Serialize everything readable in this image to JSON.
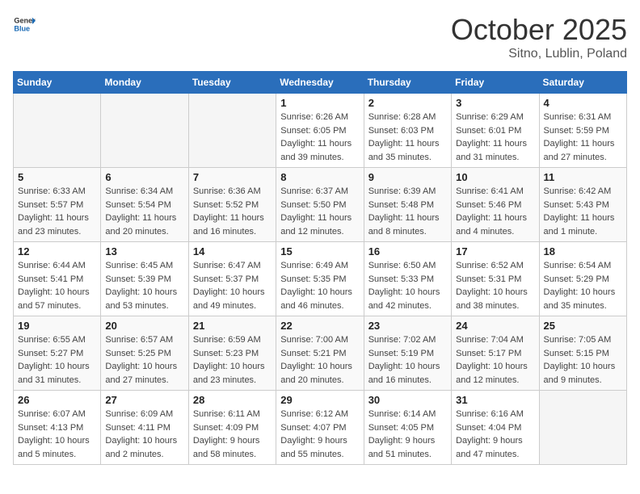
{
  "header": {
    "logo_line1": "General",
    "logo_line2": "Blue",
    "month": "October 2025",
    "location": "Sitno, Lublin, Poland"
  },
  "weekdays": [
    "Sunday",
    "Monday",
    "Tuesday",
    "Wednesday",
    "Thursday",
    "Friday",
    "Saturday"
  ],
  "weeks": [
    [
      {
        "day": "",
        "info": ""
      },
      {
        "day": "",
        "info": ""
      },
      {
        "day": "",
        "info": ""
      },
      {
        "day": "1",
        "info": "Sunrise: 6:26 AM\nSunset: 6:05 PM\nDaylight: 11 hours\nand 39 minutes."
      },
      {
        "day": "2",
        "info": "Sunrise: 6:28 AM\nSunset: 6:03 PM\nDaylight: 11 hours\nand 35 minutes."
      },
      {
        "day": "3",
        "info": "Sunrise: 6:29 AM\nSunset: 6:01 PM\nDaylight: 11 hours\nand 31 minutes."
      },
      {
        "day": "4",
        "info": "Sunrise: 6:31 AM\nSunset: 5:59 PM\nDaylight: 11 hours\nand 27 minutes."
      }
    ],
    [
      {
        "day": "5",
        "info": "Sunrise: 6:33 AM\nSunset: 5:57 PM\nDaylight: 11 hours\nand 23 minutes."
      },
      {
        "day": "6",
        "info": "Sunrise: 6:34 AM\nSunset: 5:54 PM\nDaylight: 11 hours\nand 20 minutes."
      },
      {
        "day": "7",
        "info": "Sunrise: 6:36 AM\nSunset: 5:52 PM\nDaylight: 11 hours\nand 16 minutes."
      },
      {
        "day": "8",
        "info": "Sunrise: 6:37 AM\nSunset: 5:50 PM\nDaylight: 11 hours\nand 12 minutes."
      },
      {
        "day": "9",
        "info": "Sunrise: 6:39 AM\nSunset: 5:48 PM\nDaylight: 11 hours\nand 8 minutes."
      },
      {
        "day": "10",
        "info": "Sunrise: 6:41 AM\nSunset: 5:46 PM\nDaylight: 11 hours\nand 4 minutes."
      },
      {
        "day": "11",
        "info": "Sunrise: 6:42 AM\nSunset: 5:43 PM\nDaylight: 11 hours\nand 1 minute."
      }
    ],
    [
      {
        "day": "12",
        "info": "Sunrise: 6:44 AM\nSunset: 5:41 PM\nDaylight: 10 hours\nand 57 minutes."
      },
      {
        "day": "13",
        "info": "Sunrise: 6:45 AM\nSunset: 5:39 PM\nDaylight: 10 hours\nand 53 minutes."
      },
      {
        "day": "14",
        "info": "Sunrise: 6:47 AM\nSunset: 5:37 PM\nDaylight: 10 hours\nand 49 minutes."
      },
      {
        "day": "15",
        "info": "Sunrise: 6:49 AM\nSunset: 5:35 PM\nDaylight: 10 hours\nand 46 minutes."
      },
      {
        "day": "16",
        "info": "Sunrise: 6:50 AM\nSunset: 5:33 PM\nDaylight: 10 hours\nand 42 minutes."
      },
      {
        "day": "17",
        "info": "Sunrise: 6:52 AM\nSunset: 5:31 PM\nDaylight: 10 hours\nand 38 minutes."
      },
      {
        "day": "18",
        "info": "Sunrise: 6:54 AM\nSunset: 5:29 PM\nDaylight: 10 hours\nand 35 minutes."
      }
    ],
    [
      {
        "day": "19",
        "info": "Sunrise: 6:55 AM\nSunset: 5:27 PM\nDaylight: 10 hours\nand 31 minutes."
      },
      {
        "day": "20",
        "info": "Sunrise: 6:57 AM\nSunset: 5:25 PM\nDaylight: 10 hours\nand 27 minutes."
      },
      {
        "day": "21",
        "info": "Sunrise: 6:59 AM\nSunset: 5:23 PM\nDaylight: 10 hours\nand 23 minutes."
      },
      {
        "day": "22",
        "info": "Sunrise: 7:00 AM\nSunset: 5:21 PM\nDaylight: 10 hours\nand 20 minutes."
      },
      {
        "day": "23",
        "info": "Sunrise: 7:02 AM\nSunset: 5:19 PM\nDaylight: 10 hours\nand 16 minutes."
      },
      {
        "day": "24",
        "info": "Sunrise: 7:04 AM\nSunset: 5:17 PM\nDaylight: 10 hours\nand 12 minutes."
      },
      {
        "day": "25",
        "info": "Sunrise: 7:05 AM\nSunset: 5:15 PM\nDaylight: 10 hours\nand 9 minutes."
      }
    ],
    [
      {
        "day": "26",
        "info": "Sunrise: 6:07 AM\nSunset: 4:13 PM\nDaylight: 10 hours\nand 5 minutes."
      },
      {
        "day": "27",
        "info": "Sunrise: 6:09 AM\nSunset: 4:11 PM\nDaylight: 10 hours\nand 2 minutes."
      },
      {
        "day": "28",
        "info": "Sunrise: 6:11 AM\nSunset: 4:09 PM\nDaylight: 9 hours\nand 58 minutes."
      },
      {
        "day": "29",
        "info": "Sunrise: 6:12 AM\nSunset: 4:07 PM\nDaylight: 9 hours\nand 55 minutes."
      },
      {
        "day": "30",
        "info": "Sunrise: 6:14 AM\nSunset: 4:05 PM\nDaylight: 9 hours\nand 51 minutes."
      },
      {
        "day": "31",
        "info": "Sunrise: 6:16 AM\nSunset: 4:04 PM\nDaylight: 9 hours\nand 47 minutes."
      },
      {
        "day": "",
        "info": ""
      }
    ]
  ]
}
